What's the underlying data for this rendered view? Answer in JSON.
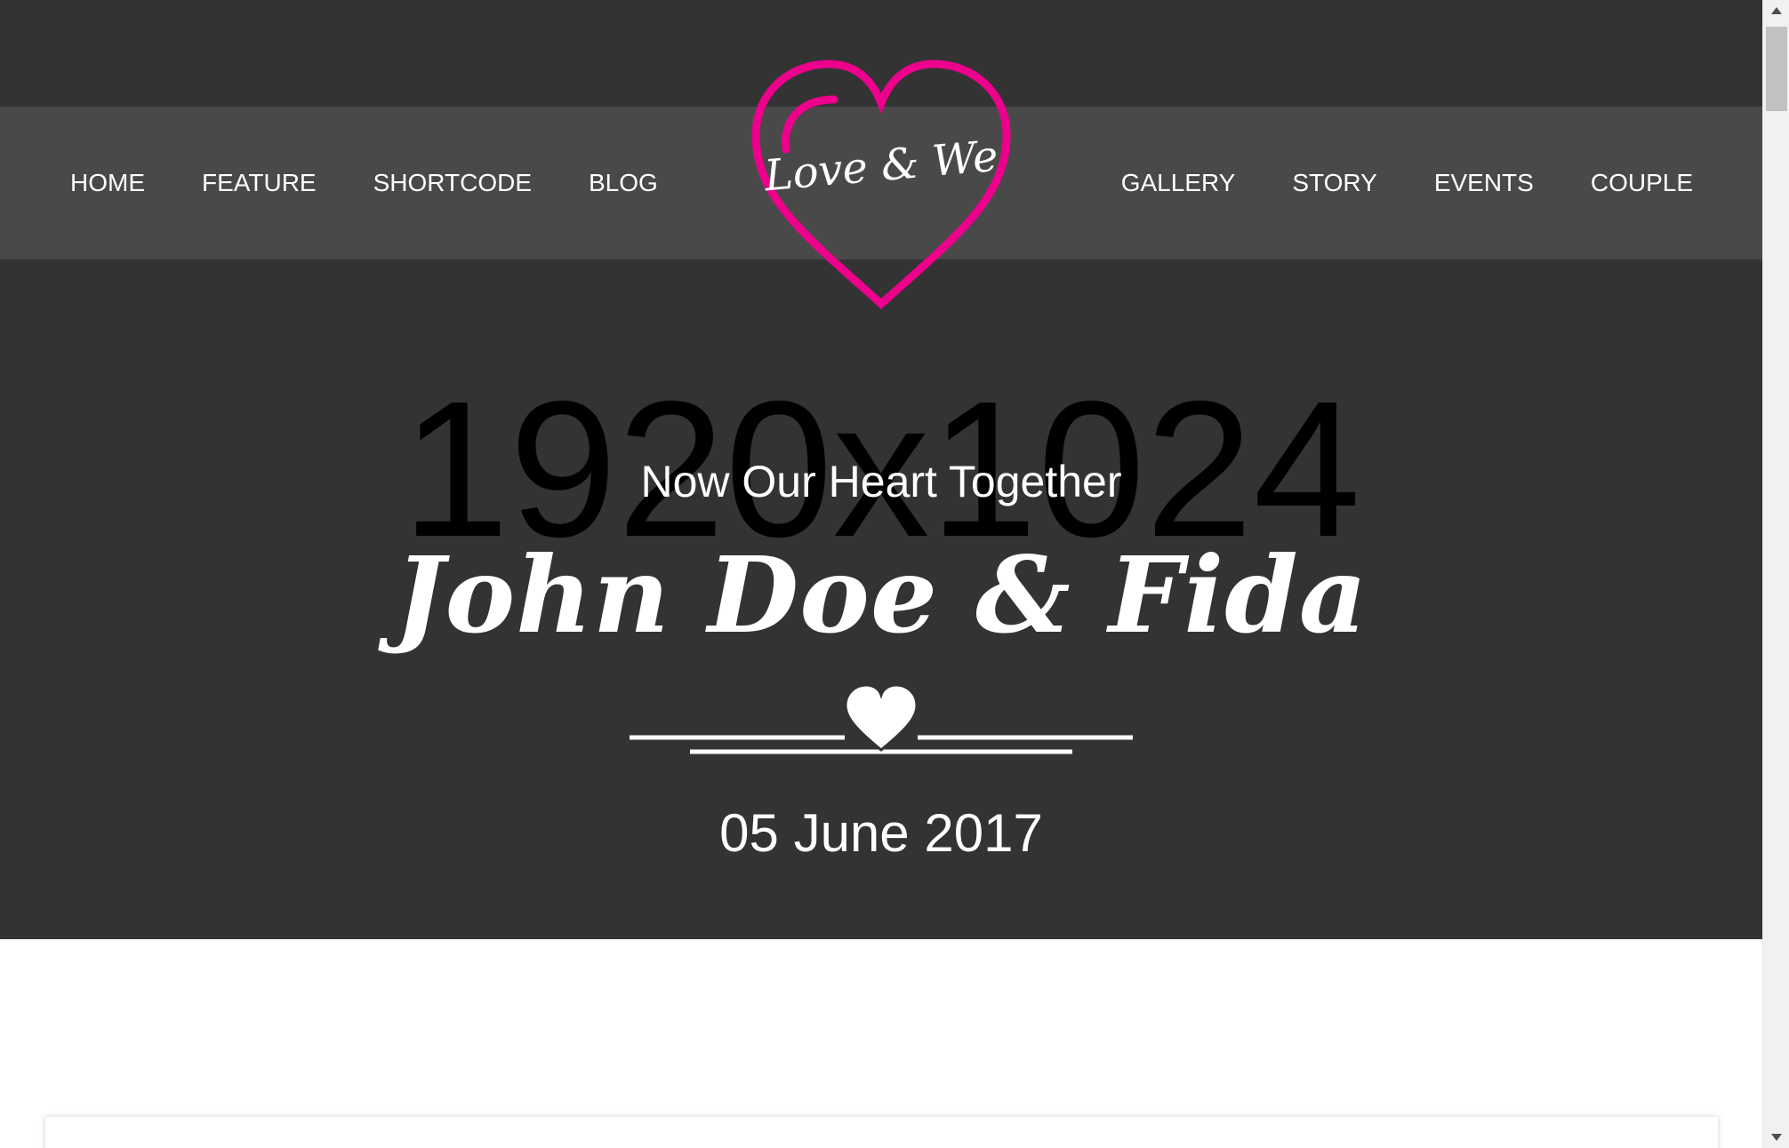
{
  "nav": {
    "left_items": [
      "HOME",
      "FEATURE",
      "SHORTCODE",
      "BLOG"
    ],
    "right_items": [
      "GALLERY",
      "STORY",
      "EVENTS",
      "COUPLE"
    ]
  },
  "logo": {
    "text": "Love & We",
    "heart_color": "#ec008c"
  },
  "hero": {
    "placeholder": "1920x1024",
    "tagline": "Now Our Heart Together",
    "couple_names": "John Doe & Fida",
    "date": "05 June 2017"
  },
  "colors": {
    "hero_background": "#333333",
    "nav_background": "#494949",
    "accent": "#ec008c",
    "text": "#ffffff"
  },
  "icons": {
    "logo": "heart-outline-icon",
    "divider": "heart-icon",
    "scroll_up": "chevron-up-icon",
    "scroll_down": "chevron-down-icon"
  }
}
